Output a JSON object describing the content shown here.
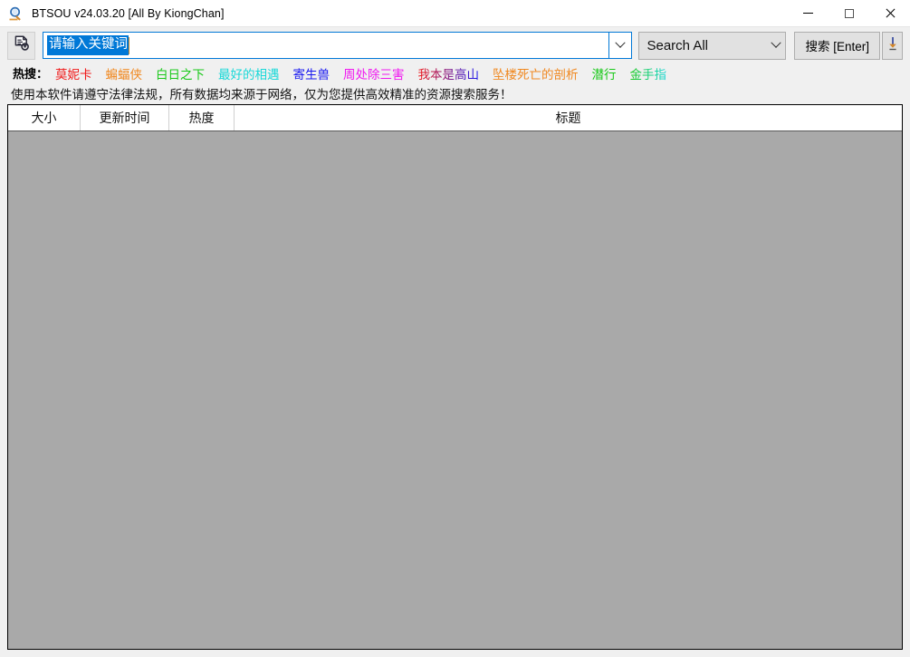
{
  "window": {
    "title": "BTSOU v24.03.20 [All By KiongChan]",
    "app_icon": "magnifier-icon",
    "minimize_label": "−",
    "maximize_label": "□",
    "close_label": "×"
  },
  "toolbar": {
    "doc_settings_icon": "document-settings-icon",
    "search_value": "请输入关键词",
    "search_placeholder": "请输入关键词",
    "search_dropdown_icon": "chevron-down-icon",
    "scope_selected": "Search All",
    "scope_dropdown_icon": "chevron-down-icon",
    "search_button_label": "搜索 [Enter]",
    "download_icon": "download-arrow-icon"
  },
  "hot_search": {
    "label": "热搜：",
    "items": [
      {
        "text": "莫妮卡",
        "color": "#f01818"
      },
      {
        "text": "蝙蝠侠",
        "color": "#f08820"
      },
      {
        "text": "白日之下",
        "color": "#18c818"
      },
      {
        "text": "最好的相遇",
        "color": "#18d8d8"
      },
      {
        "text": "寄生兽",
        "color": "#1818f0"
      },
      {
        "text": "周处除三害",
        "color": "#f018f0"
      },
      {
        "text": "我本是高山",
        "color": "#f01818",
        "color_end": "#1818f0",
        "gradient": true
      },
      {
        "text": "坠楼死亡的剖析",
        "color": "#f08820"
      },
      {
        "text": "潜行",
        "color": "#18c818"
      },
      {
        "text": "金手指",
        "color": "#18c818",
        "color_end": "#18d8d8",
        "gradient": true
      }
    ]
  },
  "disclaimer": {
    "text": "使用本软件请遵守法律法规，所有数据均来源于网络，仅为您提供高效精准的资源搜索服务！"
  },
  "results_table": {
    "columns": [
      {
        "label": "大小"
      },
      {
        "label": "更新时间"
      },
      {
        "label": "热度"
      },
      {
        "label": "标题"
      }
    ],
    "rows": []
  },
  "colors": {
    "accent": "#0078d7",
    "window_bg": "#f0f0f0",
    "list_bg": "#a9a9a9",
    "header_bg": "#ffffff"
  }
}
